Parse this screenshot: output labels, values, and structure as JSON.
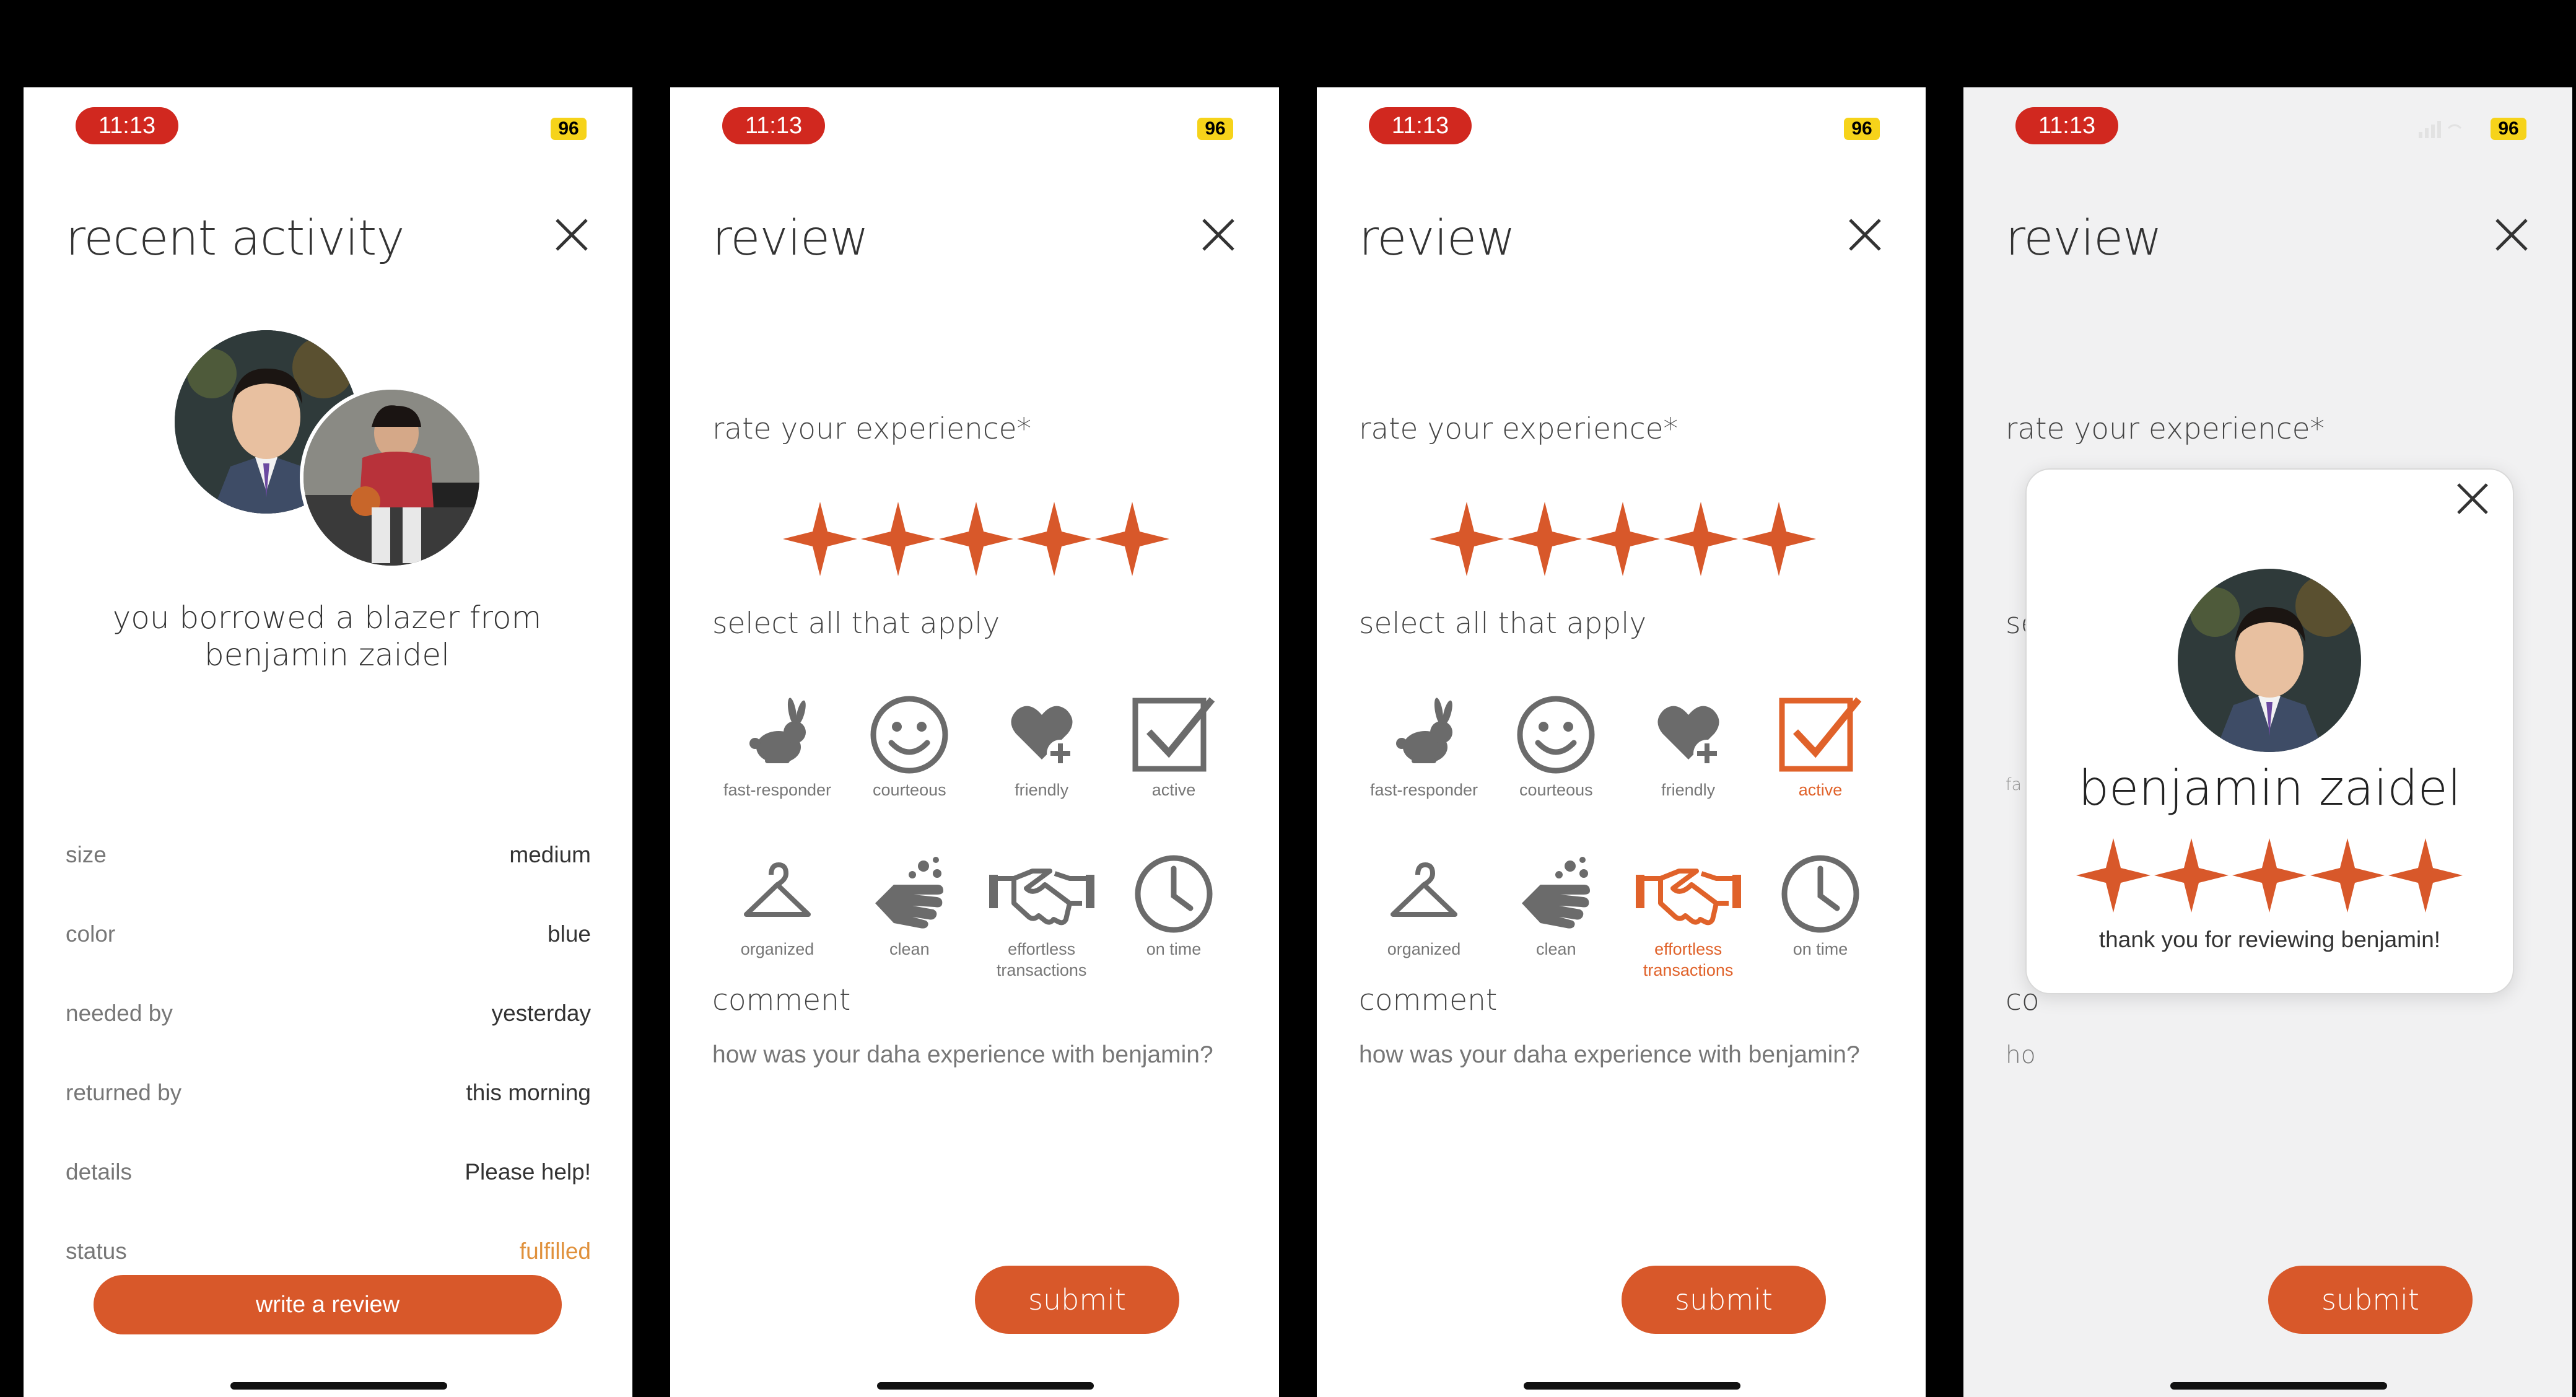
{
  "status_bar": {
    "time": "11:13",
    "battery": "96"
  },
  "screens": [
    {
      "title": "recent activity",
      "message": "you borrowed a blazer from benjamin zaidel",
      "details": [
        {
          "label": "size",
          "value": "medium"
        },
        {
          "label": "color",
          "value": "blue"
        },
        {
          "label": "needed by",
          "value": "yesterday"
        },
        {
          "label": "returned by",
          "value": "this morning"
        },
        {
          "label": "details",
          "value": "Please help!"
        },
        {
          "label": "status",
          "value": "fulfilled"
        }
      ],
      "button": "write a review"
    },
    {
      "title": "review",
      "rate_label": "rate your experience*",
      "select_label": "select all that apply",
      "comment_label": "comment",
      "comment_placeholder": "how was your daha experience with benjamin?",
      "submit": "submit"
    },
    {
      "title": "review",
      "rate_label": "rate your experience*",
      "select_label": "select all that apply",
      "comment_label": "comment",
      "comment_placeholder": "how was your daha experience with benjamin?",
      "submit": "submit"
    },
    {
      "title": "review",
      "rate_label": "rate your experience*",
      "submit": "submit"
    }
  ],
  "tags": {
    "fast_responder": "fast-responder",
    "courteous": "courteous",
    "friendly": "friendly",
    "active": "active",
    "organized": "organized",
    "clean": "clean",
    "effortless_1": "effortless",
    "effortless_2": "transactions",
    "on_time": "on time"
  },
  "rating": {
    "value": 5,
    "max": 5
  },
  "selected_tags_screen3": [
    "active",
    "effortless transactions"
  ],
  "modal": {
    "name": "benjamin zaidel",
    "thanks": "thank you for reviewing benjamin!"
  },
  "colors": {
    "accent": "#d8582a",
    "time_pill": "#d1281f",
    "battery": "#f6d31a",
    "gray_icon": "#6b6b6b"
  }
}
